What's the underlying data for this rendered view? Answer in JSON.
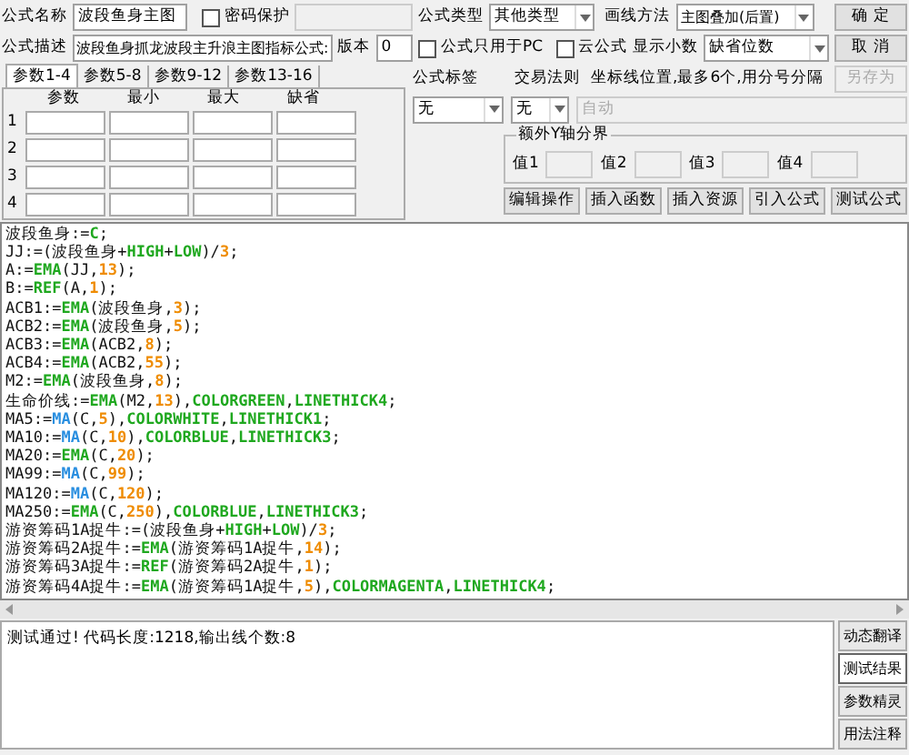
{
  "header": {
    "name_label": "公式名称",
    "name_value": "波段鱼身主图",
    "password": {
      "label": "密码保护",
      "checked": false
    },
    "desc_label": "公式描述",
    "desc_value": "波段鱼身抓龙波段主升浪主图指标公式:",
    "version_label": "版本",
    "version_value": "0",
    "type_label": "公式类型",
    "type_value": "其他类型",
    "draw_label": "画线方法",
    "draw_value": "主图叠加(后置)",
    "pc_only": {
      "label": "公式只用于PC",
      "checked": false
    },
    "cloud": {
      "label": "云公式",
      "checked": false
    },
    "decimals_label": "显示小数",
    "decimals_value": "缺省位数"
  },
  "side_buttons": [
    {
      "label": "确 定",
      "disabled": false
    },
    {
      "label": "取 消",
      "disabled": false
    },
    {
      "label": "另存为",
      "disabled": true
    }
  ],
  "param_tabs": [
    {
      "label": "参数1-4",
      "selected": true
    },
    {
      "label": "参数5-8",
      "selected": false
    },
    {
      "label": "参数9-12",
      "selected": false
    },
    {
      "label": "参数13-16",
      "selected": false
    }
  ],
  "param_columns": [
    "参数",
    "最小",
    "最大",
    "缺省"
  ],
  "param_rows": [
    "1",
    "2",
    "3",
    "4"
  ],
  "tag": {
    "label": "公式标签",
    "value": "无"
  },
  "rule": {
    "label": "交易法则",
    "value": "无"
  },
  "axis": {
    "label": "坐标线位置,最多6个,用分号分隔",
    "placeholder": "自动"
  },
  "y_split": {
    "title": "额外Y轴分界",
    "fields": [
      "值1",
      "值2",
      "值3",
      "值4"
    ]
  },
  "toolbar": [
    "编辑操作",
    "插入函数",
    "插入资源",
    "引入公式",
    "测试公式"
  ],
  "code_lines": [
    [
      {
        "text": "波段鱼身:=",
        "kind": "plain"
      },
      {
        "text": "C",
        "kind": "func"
      },
      {
        "text": ";",
        "kind": "plain"
      }
    ],
    [
      {
        "text": "JJ:=(波段鱼身+",
        "kind": "plain"
      },
      {
        "text": "HIGH",
        "kind": "func"
      },
      {
        "text": "+",
        "kind": "plain"
      },
      {
        "text": "LOW",
        "kind": "func"
      },
      {
        "text": ")/",
        "kind": "plain"
      },
      {
        "text": "3",
        "kind": "num"
      },
      {
        "text": ";",
        "kind": "plain"
      }
    ],
    [
      {
        "text": "A:=",
        "kind": "plain"
      },
      {
        "text": "EMA",
        "kind": "func"
      },
      {
        "text": "(JJ,",
        "kind": "plain"
      },
      {
        "text": "13",
        "kind": "num"
      },
      {
        "text": ");",
        "kind": "plain"
      }
    ],
    [
      {
        "text": "B:=",
        "kind": "plain"
      },
      {
        "text": "REF",
        "kind": "func"
      },
      {
        "text": "(A,",
        "kind": "plain"
      },
      {
        "text": "1",
        "kind": "num"
      },
      {
        "text": ");",
        "kind": "plain"
      }
    ],
    [
      {
        "text": "ACB1:=",
        "kind": "plain"
      },
      {
        "text": "EMA",
        "kind": "func"
      },
      {
        "text": "(波段鱼身,",
        "kind": "plain"
      },
      {
        "text": "3",
        "kind": "num"
      },
      {
        "text": ");",
        "kind": "plain"
      }
    ],
    [
      {
        "text": "ACB2:=",
        "kind": "plain"
      },
      {
        "text": "EMA",
        "kind": "func"
      },
      {
        "text": "(波段鱼身,",
        "kind": "plain"
      },
      {
        "text": "5",
        "kind": "num"
      },
      {
        "text": ");",
        "kind": "plain"
      }
    ],
    [
      {
        "text": "ACB3:=",
        "kind": "plain"
      },
      {
        "text": "EMA",
        "kind": "func"
      },
      {
        "text": "(ACB2,",
        "kind": "plain"
      },
      {
        "text": "8",
        "kind": "num"
      },
      {
        "text": ");",
        "kind": "plain"
      }
    ],
    [
      {
        "text": "ACB4:=",
        "kind": "plain"
      },
      {
        "text": "EMA",
        "kind": "func"
      },
      {
        "text": "(ACB2,",
        "kind": "plain"
      },
      {
        "text": "55",
        "kind": "num"
      },
      {
        "text": ");",
        "kind": "plain"
      }
    ],
    [
      {
        "text": "M2:=",
        "kind": "plain"
      },
      {
        "text": "EMA",
        "kind": "func"
      },
      {
        "text": "(波段鱼身,",
        "kind": "plain"
      },
      {
        "text": "8",
        "kind": "num"
      },
      {
        "text": ");",
        "kind": "plain"
      }
    ],
    [
      {
        "text": "生命价线:=",
        "kind": "plain"
      },
      {
        "text": "EMA",
        "kind": "func"
      },
      {
        "text": "(M2,",
        "kind": "plain"
      },
      {
        "text": "13",
        "kind": "num"
      },
      {
        "text": "),",
        "kind": "plain"
      },
      {
        "text": "COLORGREEN",
        "kind": "func"
      },
      {
        "text": ",",
        "kind": "plain"
      },
      {
        "text": "LINETHICK4",
        "kind": "func"
      },
      {
        "text": ";",
        "kind": "plain"
      }
    ],
    [
      {
        "text": "MA5:=",
        "kind": "plain"
      },
      {
        "text": "MA",
        "kind": "user"
      },
      {
        "text": "(C,",
        "kind": "plain"
      },
      {
        "text": "5",
        "kind": "num"
      },
      {
        "text": "),",
        "kind": "plain"
      },
      {
        "text": "COLORWHITE",
        "kind": "func"
      },
      {
        "text": ",",
        "kind": "plain"
      },
      {
        "text": "LINETHICK1",
        "kind": "func"
      },
      {
        "text": ";",
        "kind": "plain"
      }
    ],
    [
      {
        "text": "MA10:=",
        "kind": "plain"
      },
      {
        "text": "MA",
        "kind": "user"
      },
      {
        "text": "(C,",
        "kind": "plain"
      },
      {
        "text": "10",
        "kind": "num"
      },
      {
        "text": "),",
        "kind": "plain"
      },
      {
        "text": "COLORBLUE",
        "kind": "func"
      },
      {
        "text": ",",
        "kind": "plain"
      },
      {
        "text": "LINETHICK3",
        "kind": "func"
      },
      {
        "text": ";",
        "kind": "plain"
      }
    ],
    [
      {
        "text": "MA20:=",
        "kind": "plain"
      },
      {
        "text": "EMA",
        "kind": "func"
      },
      {
        "text": "(C,",
        "kind": "plain"
      },
      {
        "text": "20",
        "kind": "num"
      },
      {
        "text": ");",
        "kind": "plain"
      }
    ],
    [
      {
        "text": "MA99:=",
        "kind": "plain"
      },
      {
        "text": "MA",
        "kind": "user"
      },
      {
        "text": "(C,",
        "kind": "plain"
      },
      {
        "text": "99",
        "kind": "num"
      },
      {
        "text": ");",
        "kind": "plain"
      }
    ],
    [
      {
        "text": "MA120:=",
        "kind": "plain"
      },
      {
        "text": "MA",
        "kind": "user"
      },
      {
        "text": "(C,",
        "kind": "plain"
      },
      {
        "text": "120",
        "kind": "num"
      },
      {
        "text": ");",
        "kind": "plain"
      }
    ],
    [
      {
        "text": "MA250:=",
        "kind": "plain"
      },
      {
        "text": "EMA",
        "kind": "func"
      },
      {
        "text": "(C,",
        "kind": "plain"
      },
      {
        "text": "250",
        "kind": "num"
      },
      {
        "text": "),",
        "kind": "plain"
      },
      {
        "text": "COLORBLUE",
        "kind": "func"
      },
      {
        "text": ",",
        "kind": "plain"
      },
      {
        "text": "LINETHICK3",
        "kind": "func"
      },
      {
        "text": ";",
        "kind": "plain"
      }
    ],
    [
      {
        "text": "游资筹码1A捉牛:=(波段鱼身+",
        "kind": "plain"
      },
      {
        "text": "HIGH",
        "kind": "func"
      },
      {
        "text": "+",
        "kind": "plain"
      },
      {
        "text": "LOW",
        "kind": "func"
      },
      {
        "text": ")/",
        "kind": "plain"
      },
      {
        "text": "3",
        "kind": "num"
      },
      {
        "text": ";",
        "kind": "plain"
      }
    ],
    [
      {
        "text": "游资筹码2A捉牛:=",
        "kind": "plain"
      },
      {
        "text": "EMA",
        "kind": "func"
      },
      {
        "text": "(游资筹码1A捉牛,",
        "kind": "plain"
      },
      {
        "text": "14",
        "kind": "num"
      },
      {
        "text": ");",
        "kind": "plain"
      }
    ],
    [
      {
        "text": "游资筹码3A捉牛:=",
        "kind": "plain"
      },
      {
        "text": "REF",
        "kind": "func"
      },
      {
        "text": "(游资筹码2A捉牛,",
        "kind": "plain"
      },
      {
        "text": "1",
        "kind": "num"
      },
      {
        "text": ");",
        "kind": "plain"
      }
    ],
    [
      {
        "text": "游资筹码4A捉牛:=",
        "kind": "plain"
      },
      {
        "text": "EMA",
        "kind": "func"
      },
      {
        "text": "(游资筹码1A捉牛,",
        "kind": "plain"
      },
      {
        "text": "5",
        "kind": "num"
      },
      {
        "text": "),",
        "kind": "plain"
      },
      {
        "text": "COLORMAGENTA",
        "kind": "func"
      },
      {
        "text": ",",
        "kind": "plain"
      },
      {
        "text": "LINETHICK4",
        "kind": "func"
      },
      {
        "text": ";",
        "kind": "plain"
      }
    ]
  ],
  "message": "测试通过! 代码长度:1218,输出线个数:8",
  "result_tabs": [
    {
      "label": "动态翻译",
      "selected": false
    },
    {
      "label": "测试结果",
      "selected": true
    },
    {
      "label": "参数精灵",
      "selected": false
    },
    {
      "label": "用法注释",
      "selected": false
    }
  ]
}
